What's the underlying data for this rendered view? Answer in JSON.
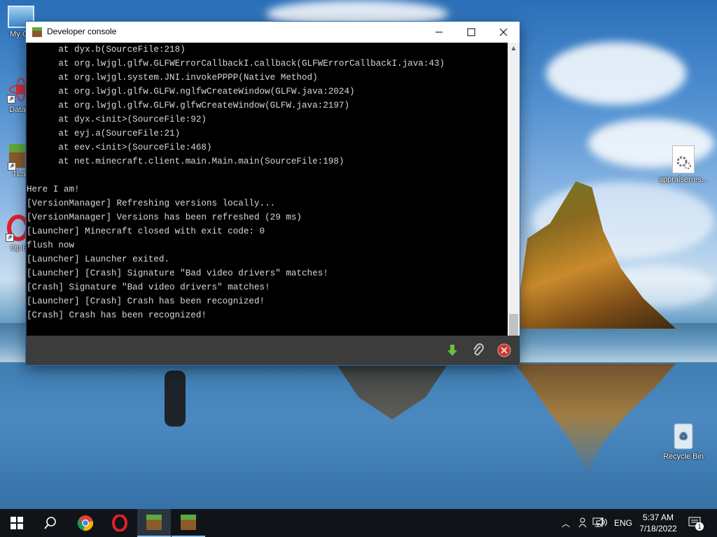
{
  "desktop": {
    "icons_left": [
      {
        "label": "My Co"
      },
      {
        "label": "DataW"
      },
      {
        "label": "TLau"
      },
      {
        "label": "Op Bro"
      }
    ],
    "icon_right": {
      "label": "appraiserres..."
    },
    "recycle_bin": {
      "label": "Recycle Bin"
    }
  },
  "window": {
    "title": "Developer console",
    "controls": {
      "minimize": "—",
      "maximize": "☐",
      "close": "✕"
    },
    "console_lines": [
      "      at dyx.b(SourceFile:218)",
      "      at org.lwjgl.glfw.GLFWErrorCallbackI.callback(GLFWErrorCallbackI.java:43)",
      "      at org.lwjgl.system.JNI.invokePPPP(Native Method)",
      "      at org.lwjgl.glfw.GLFW.nglfwCreateWindow(GLFW.java:2024)",
      "      at org.lwjgl.glfw.GLFW.glfwCreateWindow(GLFW.java:2197)",
      "      at dyx.<init>(SourceFile:92)",
      "      at eyj.a(SourceFile:21)",
      "      at eev.<init>(SourceFile:468)",
      "      at net.minecraft.client.main.Main.main(SourceFile:198)",
      "",
      "Here I am!",
      "[VersionManager] Refreshing versions locally...",
      "[VersionManager] Versions has been refreshed (29 ms)",
      "[Launcher] Minecraft closed with exit code: 0",
      "flush now",
      "[Launcher] Launcher exited.",
      "[Launcher] [Crash] Signature \"Bad video drivers\" matches!",
      "[Crash] Signature \"Bad video drivers\" matches!",
      "[Launcher] [Crash] Crash has been recognized!",
      "[Crash] Crash has been recognized!"
    ],
    "footer_icons": [
      "download-icon",
      "attachment-icon",
      "close-circle-icon"
    ]
  },
  "taskbar": {
    "apps": [
      "windows-start-icon",
      "search-icon",
      "chrome-icon",
      "opera-icon",
      "minecraft-launcher-icon",
      "minecraft-icon"
    ],
    "tray": {
      "language": "ENG",
      "time": "5:37 AM",
      "date": "7/18/2022",
      "notifications": "1"
    }
  },
  "colors": {
    "console_bg": "#000000",
    "console_text": "#d8d8d8",
    "footer_bg": "#3c3c3c",
    "taskbar_bg": "#101418"
  }
}
